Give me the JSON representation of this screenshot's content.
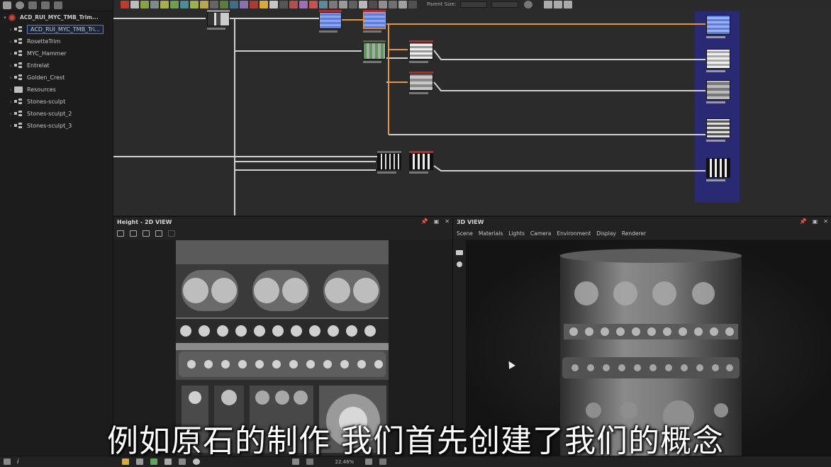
{
  "explorer": {
    "package_name": "ACD_RUI_MYC_TMB_Trim...",
    "items": [
      {
        "label": "ACD_RUI_MYC_TMB_Tri...",
        "kind": "graph",
        "selected": true
      },
      {
        "label": "RosetteTrim",
        "kind": "graph"
      },
      {
        "label": "MYC_Hammer",
        "kind": "graph"
      },
      {
        "label": "Entrelat",
        "kind": "graph"
      },
      {
        "label": "Golden_Crest",
        "kind": "graph"
      },
      {
        "label": "Resources",
        "kind": "folder"
      },
      {
        "label": "Stones-sculpt",
        "kind": "graph"
      },
      {
        "label": "Stones-sculpt_2",
        "kind": "graph"
      },
      {
        "label": "Stones-sculpt_3",
        "kind": "graph"
      }
    ]
  },
  "graph_toolbar": {
    "parent_size_label": "Parent Size:"
  },
  "view2d": {
    "title": "Height - 2D VIEW"
  },
  "view3d": {
    "title": "3D VIEW",
    "menu": [
      "Scene",
      "Materials",
      "Lights",
      "Camera",
      "Environment",
      "Display",
      "Renderer"
    ]
  },
  "statusbar": {
    "zoom": "22.46%",
    "info_icon": "i"
  },
  "subtitle": "例如原石的制作 我们首先创建了我们的概念",
  "colors": {
    "accent_blue": "#4b7fd1",
    "link_orange": "#e8962e",
    "output_frame": "#2a2a74",
    "node_red": "#b52a2a"
  }
}
